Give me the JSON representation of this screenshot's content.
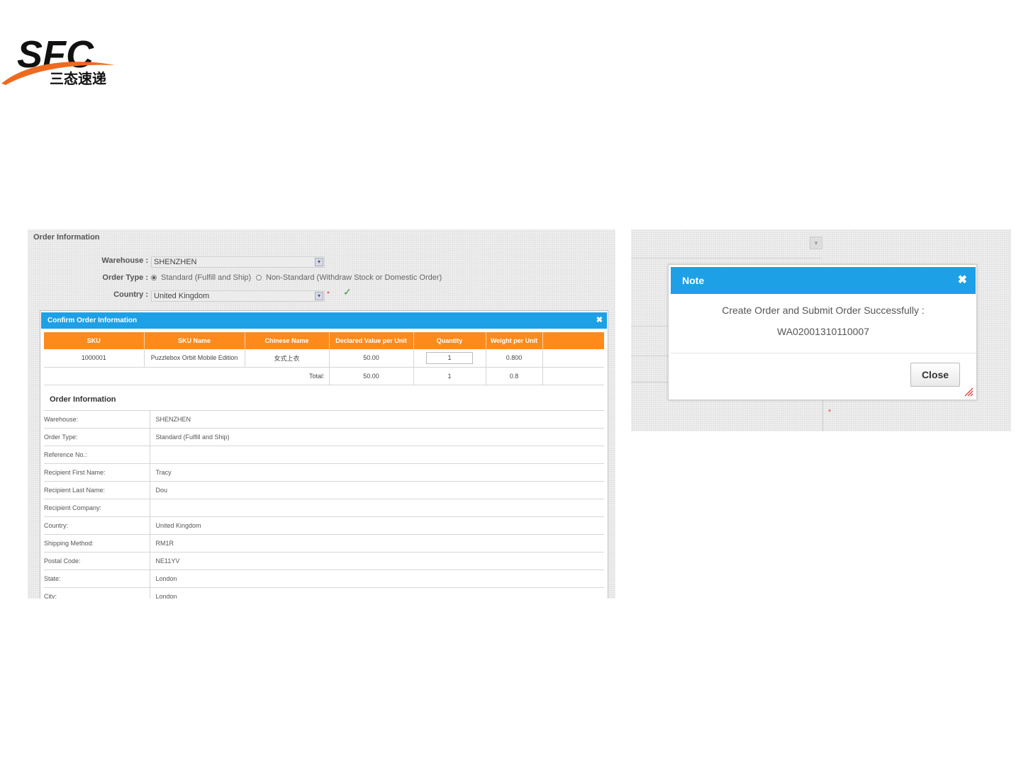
{
  "logo": {
    "brand": "SFC",
    "tagline": "三态速递",
    "colors": {
      "primary": "#111111",
      "swoosh": "#ee6a1f"
    }
  },
  "left_panel": {
    "section_title": "Order Information",
    "form": {
      "warehouse_label": "Warehouse :",
      "warehouse_value": "SHENZHEN",
      "order_type_label": "Order Type :",
      "order_type_standard": "Standard (Fulfill and Ship)",
      "order_type_nonstandard": "Non-Standard (Withdraw Stock or Domestic Order)",
      "country_label": "Country :",
      "country_value": "United Kingdom",
      "required_mark": "*",
      "valid_mark": "✓"
    },
    "dialog": {
      "title": "Confirm Order Information",
      "close": "✖",
      "columns": [
        "SKU",
        "SKU Name",
        "Chinese Name",
        "Declared Value per Unit",
        "Quantity",
        "Weight per Unit",
        ""
      ],
      "row": {
        "sku": "1000001",
        "sku_name": "Puzzlebox Orbit Mobile Edition",
        "chinese_name": "女式上衣",
        "declared": "50.00",
        "quantity": "1",
        "weight": "0.800"
      },
      "total": {
        "label": "Total:",
        "declared": "50.00",
        "quantity": "1",
        "weight": "0.8"
      },
      "info_title": "Order Information",
      "info": [
        {
          "k": "Warehouse:",
          "v": "SHENZHEN"
        },
        {
          "k": "Order Type:",
          "v": "Standard (Fulfill and Ship)"
        },
        {
          "k": "Reference No.:",
          "v": ""
        },
        {
          "k": "Recipient First Name:",
          "v": "Tracy"
        },
        {
          "k": "Recipient Last Name:",
          "v": "Dou"
        },
        {
          "k": "Recipient Company:",
          "v": ""
        },
        {
          "k": "Country:",
          "v": "United Kingdom"
        },
        {
          "k": "Shipping Method:",
          "v": "RM1R"
        },
        {
          "k": "Postal Code:",
          "v": "NE11YV"
        },
        {
          "k": "State:",
          "v": "London"
        },
        {
          "k": "City:",
          "v": "London"
        }
      ]
    }
  },
  "right_panel": {
    "note": {
      "title": "Note",
      "close": "✖",
      "message": "Create Order and Submit Order Successfully :",
      "order_number": "WA02001310110007",
      "close_button": "Close"
    },
    "required_mark": "*"
  },
  "colors": {
    "dialog_header": "#1ea0e6",
    "table_header": "#ff8a1c"
  }
}
